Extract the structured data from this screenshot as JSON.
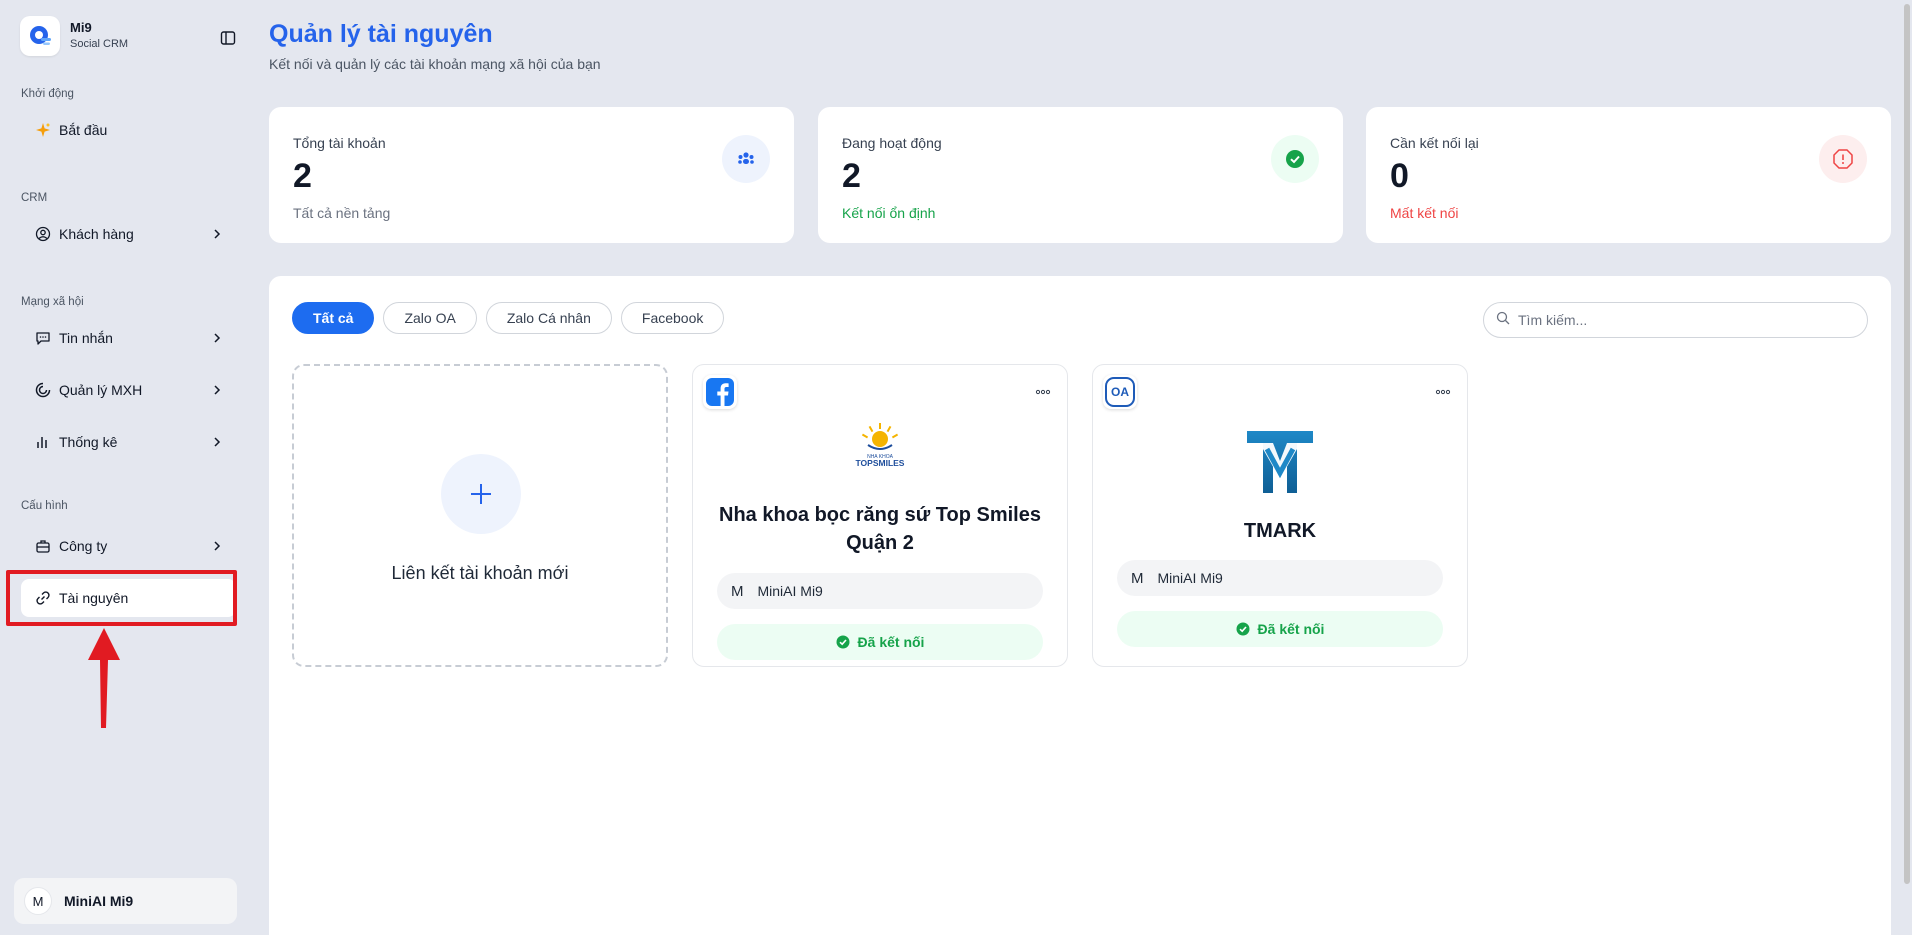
{
  "brand": {
    "name": "Mi9",
    "subtitle": "Social CRM"
  },
  "sidebar": {
    "sections": [
      {
        "label": "Khởi động"
      },
      {
        "label": "CRM"
      },
      {
        "label": "Mạng xã hội"
      },
      {
        "label": "Cấu hình"
      }
    ],
    "items": [
      {
        "label": "Bắt đầu",
        "icon": "sparkle-icon"
      },
      {
        "label": "Khách hàng",
        "icon": "user-circle-icon"
      },
      {
        "label": "Tin nhắn",
        "icon": "message-icon"
      },
      {
        "label": "Quản lý MXH",
        "icon": "loader-icon"
      },
      {
        "label": "Thống kê",
        "icon": "bar-chart-icon"
      },
      {
        "label": "Công ty",
        "icon": "briefcase-icon"
      },
      {
        "label": "Tài nguyên",
        "icon": "link-icon"
      }
    ],
    "user": {
      "initial": "M",
      "name": "MiniAI Mi9"
    }
  },
  "header": {
    "title": "Quản lý tài nguyên",
    "subtitle": "Kết nối và quản lý các tài khoản mạng xã hội của bạn"
  },
  "stats": [
    {
      "label": "Tổng tài khoản",
      "value": "2",
      "note": "Tất cả nền tảng",
      "color": "#6b7280",
      "icon": "users-icon"
    },
    {
      "label": "Đang hoạt động",
      "value": "2",
      "note": "Kết nối ổn định",
      "color": "#16a34a",
      "icon": "check-circle-icon"
    },
    {
      "label": "Cần kết nối lại",
      "value": "0",
      "note": "Mất kết nối",
      "color": "#ef4444",
      "icon": "alert-octagon-icon"
    }
  ],
  "filters": {
    "tabs": [
      "Tất cả",
      "Zalo OA",
      "Zalo Cá nhân",
      "Facebook"
    ],
    "active": "Tất cả",
    "search_placeholder": "Tìm kiếm..."
  },
  "add_card": {
    "label": "Liên kết tài khoản mới"
  },
  "accounts": [
    {
      "platform": "facebook-icon",
      "logo_text_small": "NHA KHOA",
      "logo_text": "TOPSMILES",
      "name": "Nha khoa bọc răng sứ Top Smiles Quận 2",
      "owner_initial": "M",
      "owner": "MiniAI Mi9",
      "status": "Đã kết nối"
    },
    {
      "platform": "zalo-oa-icon",
      "platform_text": "OA",
      "name": "TMARK",
      "owner_initial": "M",
      "owner": "MiniAI Mi9",
      "status": "Đã kết nối"
    }
  ],
  "colors": {
    "accent": "#2563eb",
    "success": "#16a34a",
    "danger": "#ef4444",
    "annotation": "#e11b22"
  }
}
